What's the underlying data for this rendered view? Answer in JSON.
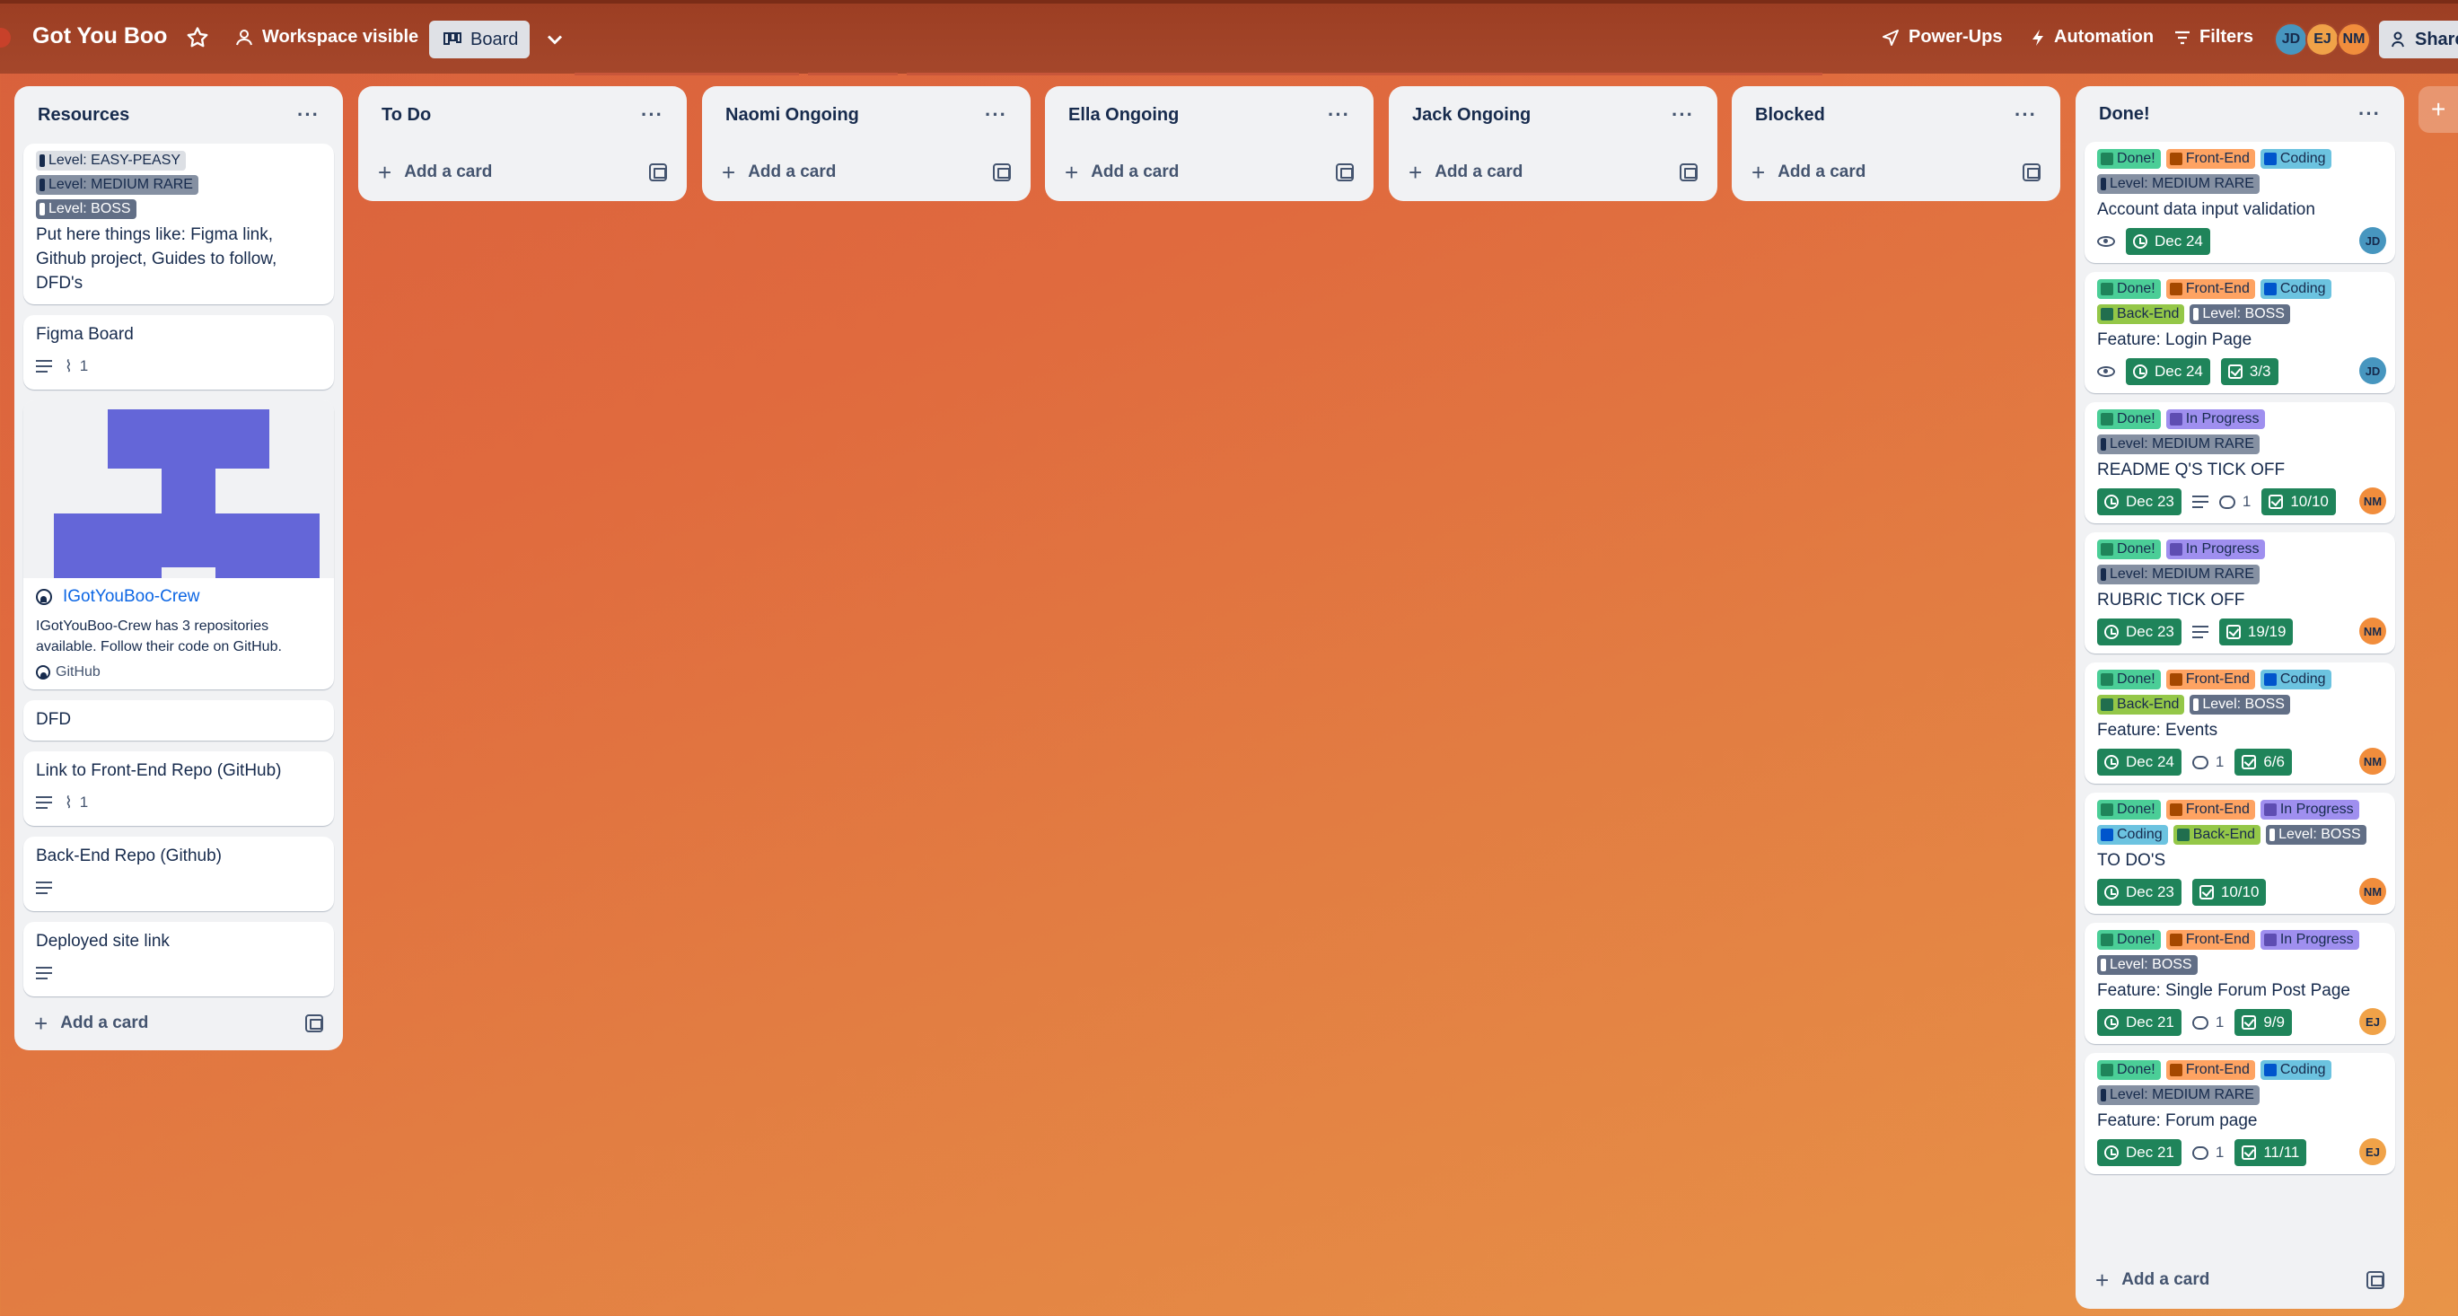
{
  "header": {
    "board_title": "Got You Boo",
    "visibility": "Workspace visible",
    "view": "Board",
    "power_ups": "Power-Ups",
    "automation": "Automation",
    "filters": "Filters",
    "share": "Share",
    "members": [
      {
        "initials": "JD",
        "color": "#4796bf"
      },
      {
        "initials": "EJ",
        "color": "#f0a248"
      },
      {
        "initials": "NM",
        "color": "#f18d3c"
      }
    ]
  },
  "add_card_label": "Add a card",
  "lists": {
    "resources": {
      "title": "Resources",
      "card1": {
        "labels": [
          "Level: EASY-PEASY",
          "Level: MEDIUM RARE",
          "Level: BOSS"
        ],
        "title": "Put here things like: Figma link, Github project, Guides to follow, DFD's"
      },
      "card2": {
        "title": "Figma Board",
        "attachments": "1"
      },
      "card3": {
        "link_title": "IGotYouBoo-Crew",
        "link_desc": "IGotYouBoo-Crew has 3 repositories available. Follow their code on GitHub.",
        "link_source": "GitHub"
      },
      "card4": {
        "title": "DFD"
      },
      "card5": {
        "title": "Link to Front-End Repo (GitHub)",
        "attachments": "1"
      },
      "card6": {
        "title": "Back-End Repo (Github)"
      },
      "card7": {
        "title": "Deployed site link"
      }
    },
    "todo": {
      "title": "To Do"
    },
    "naomi": {
      "title": "Naomi Ongoing"
    },
    "ella": {
      "title": "Ella Ongoing"
    },
    "jack": {
      "title": "Jack Ongoing"
    },
    "blocked": {
      "title": "Blocked"
    },
    "done": {
      "title": "Done!",
      "cards": [
        {
          "labels": [
            "Done!",
            "Front-End",
            "Coding",
            "Level: MEDIUM RARE"
          ],
          "title": "Account data input validation",
          "date": "Dec 24",
          "member": "JD"
        },
        {
          "labels": [
            "Done!",
            "Front-End",
            "Coding",
            "Back-End",
            "Level: BOSS"
          ],
          "title": "Feature: Login Page",
          "date": "Dec 24",
          "checklist": "3/3",
          "member": "JD"
        },
        {
          "labels": [
            "Done!",
            "In Progress",
            "Level: MEDIUM RARE"
          ],
          "title": "README Q'S TICK OFF",
          "date": "Dec 23",
          "comments": "1",
          "checklist": "10/10",
          "member": "NM"
        },
        {
          "labels": [
            "Done!",
            "In Progress",
            "Level: MEDIUM RARE"
          ],
          "title": "RUBRIC TICK OFF",
          "date": "Dec 23",
          "checklist": "19/19",
          "member": "NM"
        },
        {
          "labels": [
            "Done!",
            "Front-End",
            "Coding",
            "Back-End",
            "Level: BOSS"
          ],
          "title": "Feature: Events",
          "date": "Dec 24",
          "comments": "1",
          "checklist": "6/6",
          "member": "NM"
        },
        {
          "labels": [
            "Done!",
            "Front-End",
            "In Progress",
            "Coding",
            "Back-End",
            "Level: BOSS"
          ],
          "title": "TO DO'S",
          "date": "Dec 23",
          "checklist": "10/10",
          "member": "NM"
        },
        {
          "labels": [
            "Done!",
            "Front-End",
            "In Progress",
            "Level: BOSS"
          ],
          "title": "Feature: Single Forum Post Page",
          "date": "Dec 21",
          "comments": "1",
          "checklist": "9/9",
          "member": "EJ"
        },
        {
          "labels": [
            "Done!",
            "Front-End",
            "Coding",
            "Level: MEDIUM RARE"
          ],
          "title": "Feature: Forum page",
          "date": "Dec 21",
          "comments": "1",
          "checklist": "11/11",
          "member": "EJ"
        }
      ]
    }
  },
  "colors": {
    "label_done": "#4bce97",
    "label_front_end": "#fea362",
    "label_coding": "#6cc3e0",
    "label_back_end": "#94c748",
    "label_boss": "#626f86",
    "label_medium": "#8590a2",
    "label_in_progress": "#9f8fef",
    "due_complete": "#1f845a",
    "figma_preview": "#6466d8"
  }
}
